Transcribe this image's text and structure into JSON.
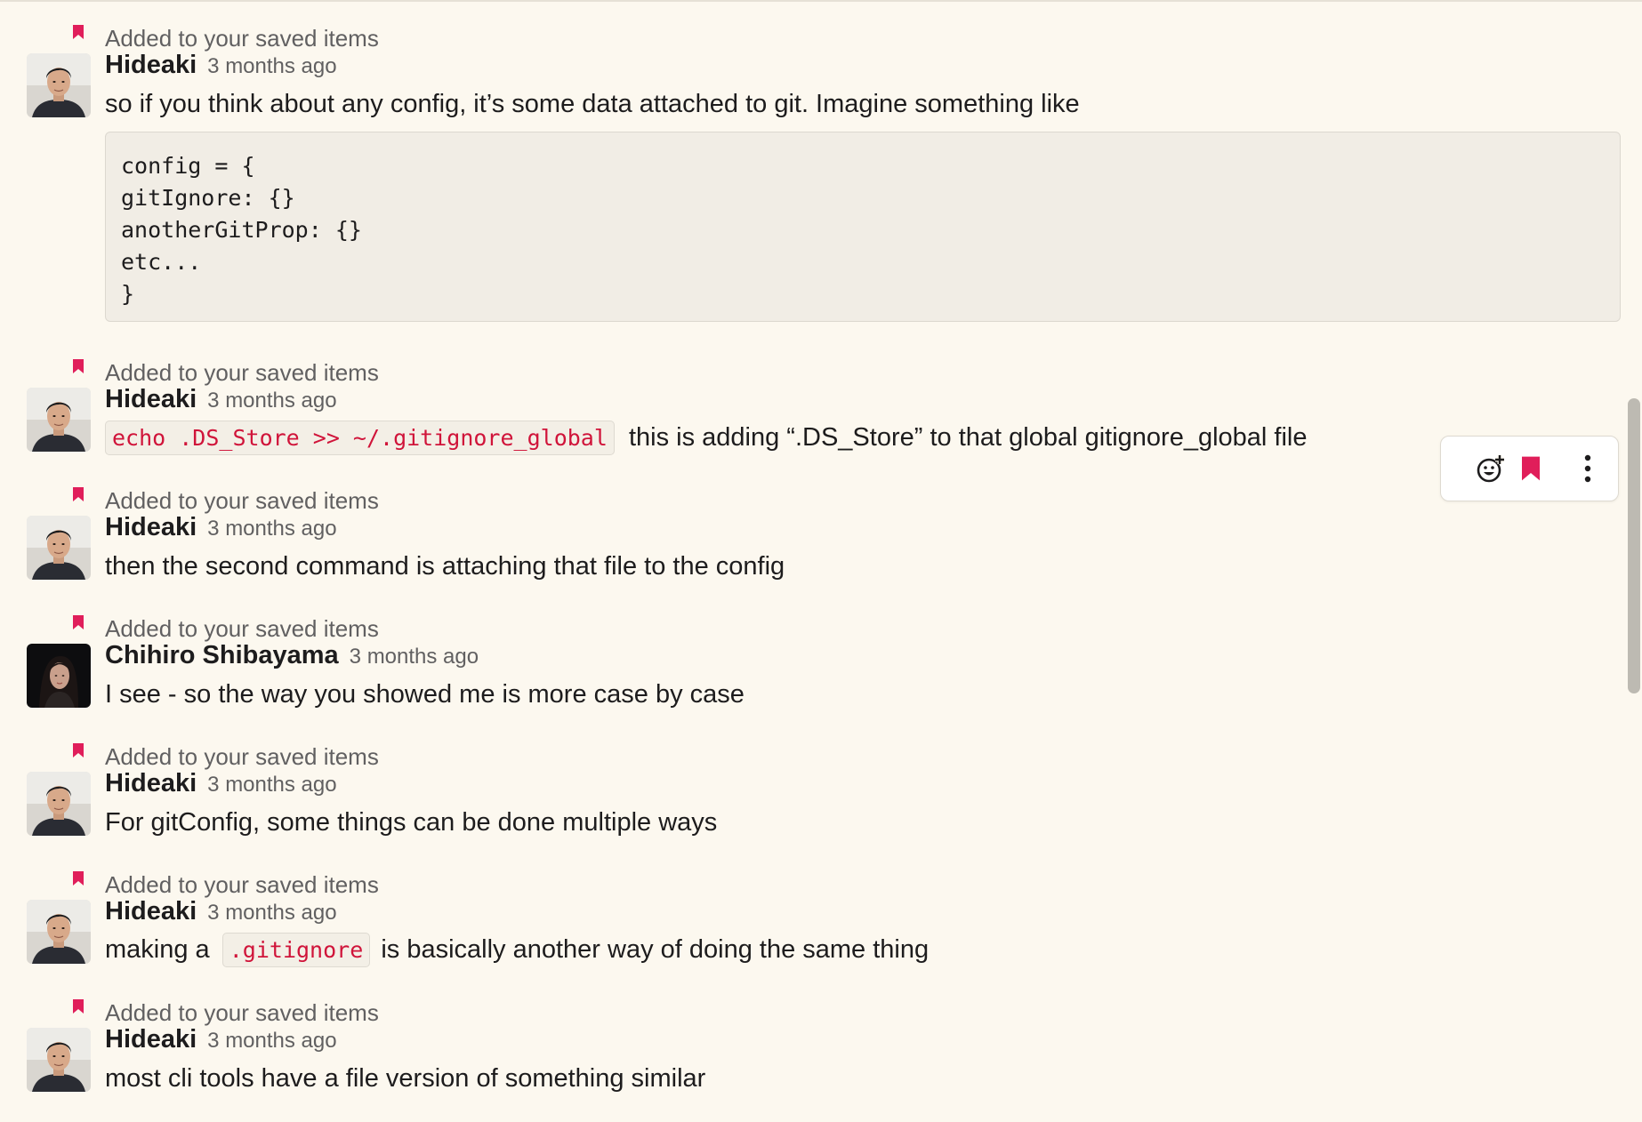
{
  "colors": {
    "background": "#fcf8ef",
    "bookmark_red": "#e01e5a",
    "muted_text": "#616061",
    "inline_code_text": "#d0143a"
  },
  "saved_label": "Added to your saved items",
  "messages": [
    {
      "author": "Hideaki",
      "time": "3 months ago",
      "text": "so if you think about any config, it’s some data attached to git. Imagine something like",
      "code_block": [
        "config = {",
        "gitIgnore: {}",
        "anotherGitProp: {}",
        "etc...",
        "}"
      ]
    },
    {
      "author": "Hideaki",
      "time": "3 months ago",
      "code": "echo .DS_Store >> ~/.gitignore_global",
      "text_after": "this is adding “.DS_Store” to that global gitignore_global file"
    },
    {
      "author": "Hideaki",
      "time": "3 months ago",
      "text": "then the second command is attaching that file to the config"
    },
    {
      "author": "Chihiro Shibayama",
      "time": "3 months ago",
      "text": "I see - so the way you showed me is more case by case"
    },
    {
      "author": "Hideaki",
      "time": "3 months ago",
      "text": "For gitConfig, some things can be done multiple ways"
    },
    {
      "author": "Hideaki",
      "time": "3 months ago",
      "text_before": "making a",
      "code": ".gitignore",
      "text_after": "is basically another way of doing the same thing"
    },
    {
      "author": "Hideaki",
      "time": "3 months ago",
      "text": "most cli tools have a file version of something similar"
    }
  ],
  "hover_toolbar": {
    "icons": [
      "add-reaction-icon",
      "bookmark-icon",
      "more-actions-icon"
    ]
  }
}
